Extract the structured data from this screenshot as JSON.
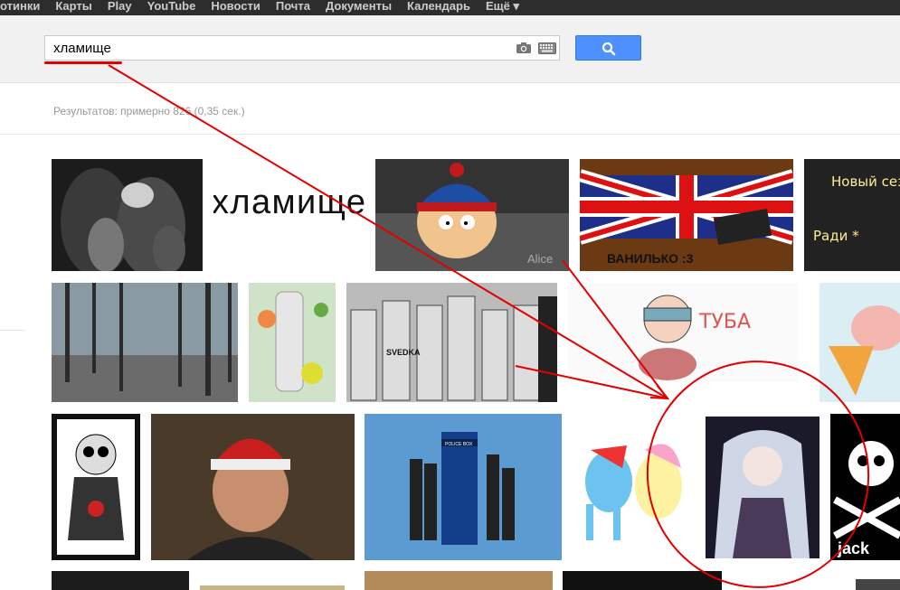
{
  "topbar": {
    "items": [
      "отинки",
      "Карты",
      "Play",
      "YouTube",
      "Новости",
      "Почта",
      "Документы",
      "Календарь",
      "Ещё ▾"
    ]
  },
  "search": {
    "query": "хламище",
    "camera_icon": "camera-icon",
    "keyboard_icon": "keyboard-icon",
    "button_icon": "search-icon"
  },
  "results": {
    "count_text": "Результатов: примерно 826 (0,35 сек.)"
  },
  "thumbnails": {
    "word_image_text": "хламище",
    "alice_caption": "Alice",
    "vanilka_caption": "ВАНИЛЬКО :3",
    "tuba_caption": "ТУБА",
    "novy_text": "Новый сез",
    "radi_text": "Ради *",
    "tardis_label": "POLICE BOX",
    "svedka_label": "SVEDKA",
    "jack_label": "jack"
  },
  "colors": {
    "topbar": "#2d2d2d",
    "header": "#f1f1f1",
    "search_button": "#4d90fe",
    "annotation": "#e20000"
  }
}
